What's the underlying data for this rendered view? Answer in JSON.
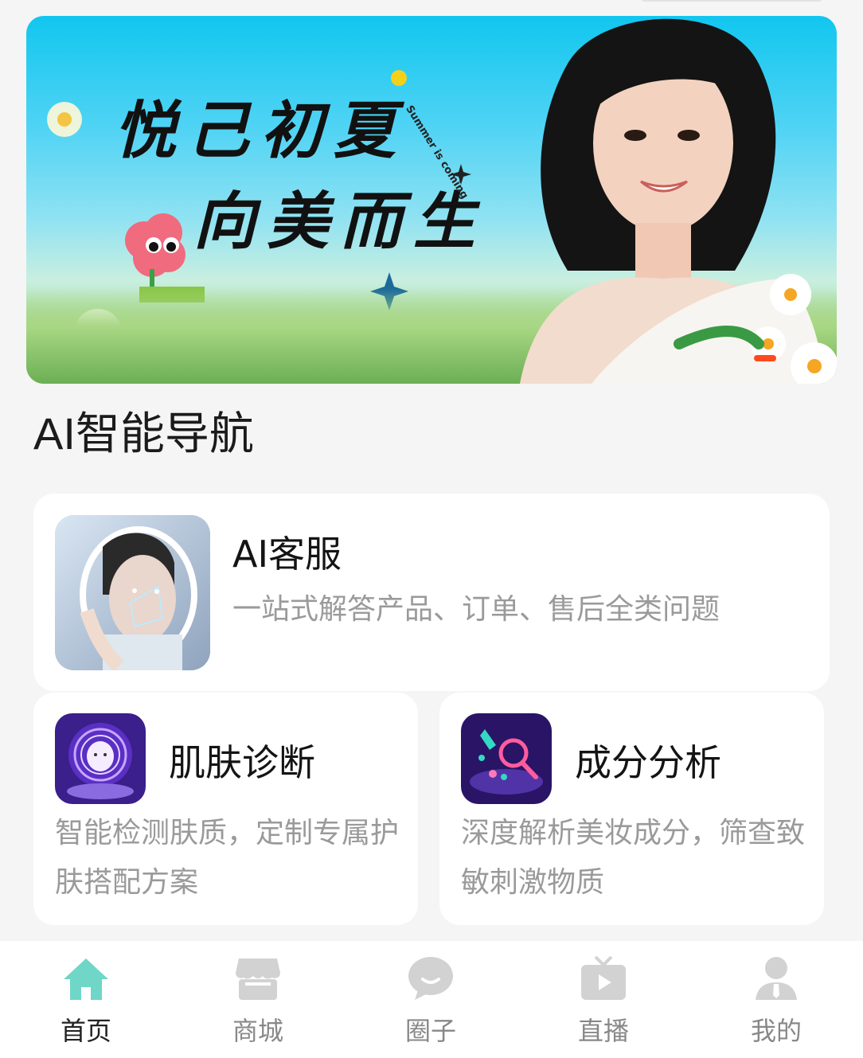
{
  "banner": {
    "headline_line1": "悦己初夏",
    "headline_line2": "向美而生",
    "tag": "Summer is coming"
  },
  "section": {
    "title": "AI智能导航"
  },
  "cards": {
    "service": {
      "title": "AI客服",
      "desc": "一站式解答产品、订单、售后全类问题"
    },
    "skin": {
      "title": "肌肤诊断",
      "desc": "智能检测肤质，定制专属护肤搭配方案"
    },
    "ingredient": {
      "title": "成分分析",
      "desc": "深度解析美妆成分，筛查致敏刺激物质"
    }
  },
  "tabbar": {
    "items": [
      {
        "label": "首页",
        "icon": "home-icon",
        "active": true
      },
      {
        "label": "商城",
        "icon": "store-icon",
        "active": false
      },
      {
        "label": "圈子",
        "icon": "chat-bubble-icon",
        "active": false
      },
      {
        "label": "直播",
        "icon": "tv-play-icon",
        "active": false
      },
      {
        "label": "我的",
        "icon": "user-icon",
        "active": false
      }
    ],
    "active_color": "#6fd6c8",
    "inactive_color": "#d2d2d2"
  }
}
